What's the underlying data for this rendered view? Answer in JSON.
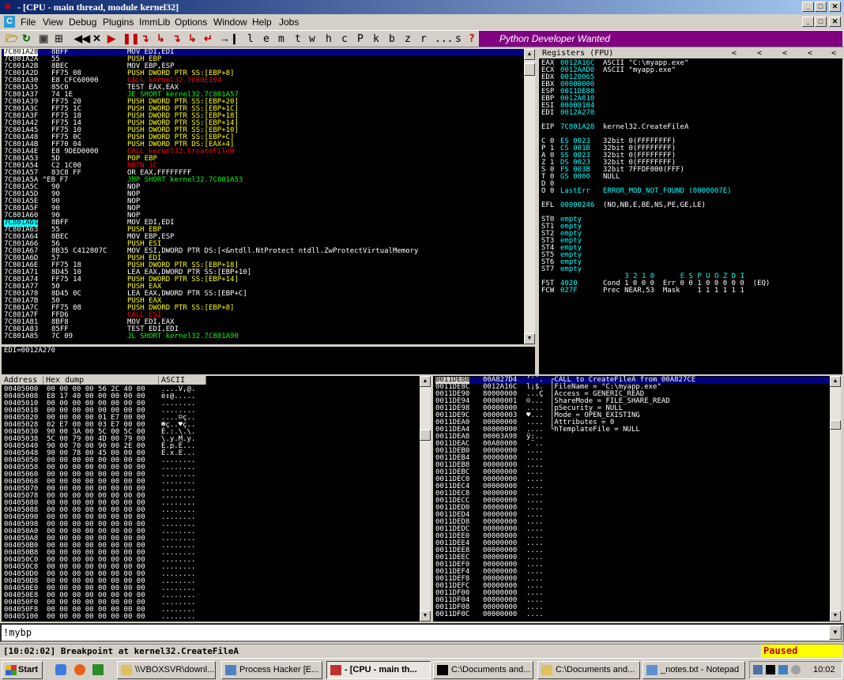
{
  "window": {
    "title": "- [CPU - main thread, module kernel32]"
  },
  "menu": [
    "File",
    "View",
    "Debug",
    "Plugins",
    "ImmLib",
    "Options",
    "Window",
    "Help",
    "Jobs"
  ],
  "toolbar": {
    "letters": [
      "l",
      "e",
      "m",
      "t",
      "w",
      "h",
      "c",
      "P",
      "k",
      "b",
      "z",
      "r",
      "...",
      "s",
      "?"
    ],
    "banner": "Python Developer Wanted"
  },
  "disasm": {
    "rows": [
      [
        "7C801A28",
        "8BFF",
        "MOV EDI,EDI",
        "mov"
      ],
      [
        "7C801A2A",
        "55",
        "PUSH EBP",
        "push"
      ],
      [
        "7C801A2B",
        "8BEC",
        "MOV EBP,ESP",
        "mov"
      ],
      [
        "7C801A2D",
        "FF75 08",
        "PUSH DWORD PTR SS:[EBP+8]",
        "push"
      ],
      [
        "7C801A30",
        "E8 CFC60000",
        "CALL kernel32.7C80E104",
        "call"
      ],
      [
        "7C801A35",
        "85C0",
        "TEST EAX,EAX",
        "test"
      ],
      [
        "7C801A37",
        "74 1E",
        "JE SHORT kernel32.7C801A57",
        "jmp"
      ],
      [
        "7C801A39",
        "FF75 20",
        "PUSH DWORD PTR SS:[EBP+20]",
        "push"
      ],
      [
        "7C801A3C",
        "FF75 1C",
        "PUSH DWORD PTR SS:[EBP+1C]",
        "push"
      ],
      [
        "7C801A3F",
        "FF75 18",
        "PUSH DWORD PTR SS:[EBP+18]",
        "push"
      ],
      [
        "7C801A42",
        "FF75 14",
        "PUSH DWORD PTR SS:[EBP+14]",
        "push"
      ],
      [
        "7C801A45",
        "FF75 10",
        "PUSH DWORD PTR SS:[EBP+10]",
        "push"
      ],
      [
        "7C801A48",
        "FF75 0C",
        "PUSH DWORD PTR SS:[EBP+C]",
        "push"
      ],
      [
        "7C801A4B",
        "FF70 04",
        "PUSH DWORD PTR DS:[EAX+4]",
        "push"
      ],
      [
        "7C801A4E",
        "E8 9DED0000",
        "CALL kernel32.CreateFileW",
        "call"
      ],
      [
        "7C801A53",
        "5D",
        "POP EBP",
        "push"
      ],
      [
        "7C801A54",
        "C2 1C00",
        "RETN 1C",
        "ret"
      ],
      [
        "7C801A57",
        "83C8 FF",
        "OR EAX,FFFFFFFF",
        "test"
      ],
      [
        "7C801A5A ^EB F7",
        "",
        "JMP SHORT kernel32.7C801A53",
        "jmp"
      ],
      [
        "7C801A5C",
        "90",
        "NOP",
        "mov"
      ],
      [
        "7C801A5D",
        "90",
        "NOP",
        "mov"
      ],
      [
        "7C801A5E",
        "90",
        "NOP",
        "mov"
      ],
      [
        "7C801A5F",
        "90",
        "NOP",
        "mov"
      ],
      [
        "7C801A60",
        "90",
        "NOP",
        "mov"
      ],
      [
        "7C801A61",
        "8BFF",
        "MOV EDI,EDI",
        "test"
      ],
      [
        "7C801A63",
        "55",
        "PUSH EBP",
        "push"
      ],
      [
        "7C801A64",
        "8BEC",
        "MOV EBP,ESP",
        "test"
      ],
      [
        "7C801A66",
        "56",
        "PUSH ESI",
        "push"
      ],
      [
        "7C801A67",
        "8B35 C412807C",
        "MOV ESI,DWORD PTR DS:[<&ntdll.NtProtect ntdll.ZwProtectVirtualMemory",
        "test"
      ],
      [
        "7C801A6D",
        "57",
        "PUSH EDI",
        "push"
      ],
      [
        "7C801A6E",
        "FF75 18",
        "PUSH DWORD PTR SS:[EBP+18]",
        "push"
      ],
      [
        "7C801A71",
        "8D45 10",
        "LEA EAX,DWORD PTR SS:[EBP+10]",
        "mov"
      ],
      [
        "7C801A74",
        "FF75 14",
        "PUSH DWORD PTR SS:[EBP+14]",
        "push"
      ],
      [
        "7C801A77",
        "50",
        "PUSH EAX",
        "push"
      ],
      [
        "7C801A78",
        "8D45 0C",
        "LEA EAX,DWORD PTR SS:[EBP+C]",
        "mov"
      ],
      [
        "7C801A7B",
        "50",
        "PUSH EAX",
        "push"
      ],
      [
        "7C801A7C",
        "FF75 08",
        "PUSH DWORD PTR SS:[EBP+8]",
        "push"
      ],
      [
        "7C801A7F",
        "FFD6",
        "CALL ESI",
        "call"
      ],
      [
        "7C801A81",
        "8BF8",
        "MOV EDI,EAX",
        "test"
      ],
      [
        "7C801A83",
        "85FF",
        "TEST EDI,EDI",
        "test"
      ],
      [
        "7C801A85",
        "7C 09",
        "JL SHORT kernel32.7C801A90",
        "jmp"
      ]
    ],
    "info": "EDI=0012A270"
  },
  "registers": {
    "title": "Registers (FPU)",
    "lines": [
      [
        "EAX",
        "0012A16C",
        "ASCII \"C:\\myapp.exe\""
      ],
      [
        "ECX",
        "0012AAD0",
        "ASCII \"myapp.exe\""
      ],
      [
        "EDX",
        "00120065",
        ""
      ],
      [
        "EBX",
        "00000000",
        ""
      ],
      [
        "ESP",
        "0011DE88",
        ""
      ],
      [
        "EBP",
        "0012A810",
        ""
      ],
      [
        "ESI",
        "00000104",
        ""
      ],
      [
        "EDI",
        "0012A270",
        ""
      ],
      [
        "",
        "",
        " "
      ],
      [
        "EIP",
        "7C801A28",
        "kernel32.CreateFileA"
      ],
      [
        "",
        "",
        " "
      ],
      [
        "C 0",
        "ES 0023",
        "32bit 0(FFFFFFFF)"
      ],
      [
        "P 1",
        "CS 001B",
        "32bit 0(FFFFFFFF)"
      ],
      [
        "A 0",
        "SS 0023",
        "32bit 0(FFFFFFFF)"
      ],
      [
        "Z 1",
        "DS 0023",
        "32bit 0(FFFFFFFF)"
      ],
      [
        "S 0",
        "FS 003B",
        "32bit 7FFDF000(FFF)"
      ],
      [
        "T 0",
        "GS 0000",
        "NULL"
      ],
      [
        "D 0",
        "",
        ""
      ],
      [
        "O 0",
        "LastErr",
        "ERROR_MOD_NOT_FOUND (0000007E)"
      ],
      [
        "",
        "",
        " "
      ],
      [
        "EFL",
        "00000246",
        "(NO,NB,E,BE,NS,PE,GE,LE)"
      ],
      [
        "",
        "",
        " "
      ],
      [
        "ST0",
        "empty",
        ""
      ],
      [
        "ST1",
        "empty",
        ""
      ],
      [
        "ST2",
        "empty",
        ""
      ],
      [
        "ST3",
        "empty",
        ""
      ],
      [
        "ST4",
        "empty",
        ""
      ],
      [
        "ST5",
        "empty",
        ""
      ],
      [
        "ST6",
        "empty",
        ""
      ],
      [
        "ST7",
        "empty",
        ""
      ],
      [
        "",
        "               3 2 1 0      E S P U O Z D I",
        ""
      ],
      [
        "FST",
        "4020",
        "Cond 1 0 0 0  Err 0 0 1 0 0 0 0 0  (EQ)"
      ],
      [
        "FCW",
        "027F",
        "Prec NEAR,53  Mask    1 1 1 1 1 1"
      ]
    ]
  },
  "dump": {
    "headers": [
      "Address",
      "Hex dump",
      "ASCII"
    ],
    "rows": [
      [
        "00405000",
        "00 00 00 00 56 2C 40 00",
        "....V,@."
      ],
      [
        "00405008",
        "E8 17 40 00 00 00 00 00",
        "è↕@....."
      ],
      [
        "00405010",
        "00 00 00 00 00 00 00 00",
        "........"
      ],
      [
        "00405018",
        "00 00 00 00 00 00 00 00",
        "........"
      ],
      [
        "00405020",
        "00 00 00 00 01 E7 00 00",
        "....☺ç.."
      ],
      [
        "00405028",
        "02 E7 00 00 03 E7 00 00",
        "☻ç..♥ç.."
      ],
      [
        "00405030",
        "90 00 3A 00 5C 00 5C 00",
        "É.:.\\.\\."
      ],
      [
        "00405038",
        "5C 00 79 00 4D 00 79 00",
        "\\.y.M.y."
      ],
      [
        "00405040",
        "90 00 70 00 90 00 2E 00",
        "É.p.É..."
      ],
      [
        "00405048",
        "90 00 78 00 45 00 00 00",
        "É.x.E..."
      ],
      [
        "00405050",
        "00 00 00 00 00 00 00 00",
        "........"
      ],
      [
        "00405058",
        "00 00 00 00 00 00 00 00",
        "........"
      ],
      [
        "00405060",
        "00 00 00 00 00 00 00 00",
        "........"
      ],
      [
        "00405068",
        "00 00 00 00 00 00 00 00",
        "........"
      ],
      [
        "00405070",
        "00 00 00 00 00 00 00 00",
        "........"
      ],
      [
        "00405078",
        "00 00 00 00 00 00 00 00",
        "........"
      ],
      [
        "00405080",
        "00 00 00 00 00 00 00 00",
        "........"
      ],
      [
        "00405088",
        "00 00 00 00 00 00 00 00",
        "........"
      ],
      [
        "00405090",
        "00 00 00 00 00 00 00 00",
        "........"
      ],
      [
        "00405098",
        "00 00 00 00 00 00 00 00",
        "........"
      ],
      [
        "004050A0",
        "00 00 00 00 00 00 00 00",
        "........"
      ],
      [
        "004050A8",
        "00 00 00 00 00 00 00 00",
        "........"
      ],
      [
        "004050B0",
        "00 00 00 00 00 00 00 00",
        "........"
      ],
      [
        "004050B8",
        "00 00 00 00 00 00 00 00",
        "........"
      ],
      [
        "004050C0",
        "00 00 00 00 00 00 00 00",
        "........"
      ],
      [
        "004050C8",
        "00 00 00 00 00 00 00 00",
        "........"
      ],
      [
        "004050D0",
        "00 00 00 00 00 00 00 00",
        "........"
      ],
      [
        "004050D8",
        "00 00 00 00 00 00 00 00",
        "........"
      ],
      [
        "004050E0",
        "00 00 00 00 00 00 00 00",
        "........"
      ],
      [
        "004050E8",
        "00 00 00 00 00 00 00 00",
        "........"
      ],
      [
        "004050F0",
        "00 00 00 00 00 00 00 00",
        "........"
      ],
      [
        "004050F8",
        "00 00 00 00 00 00 00 00",
        "........"
      ],
      [
        "00405100",
        "00 00 00 00 00 00 00 00",
        "........"
      ]
    ]
  },
  "stack": {
    "rows": [
      [
        "0011DE88",
        "00A827D4",
        "’'¨.",
        "┌CALL to CreateFileA from 00A827CE",
        true
      ],
      [
        "0011DE8C",
        "0012A16C",
        "l¡$.",
        "│FileName = \"C:\\myapp.exe\"",
        false
      ],
      [
        "0011DE90",
        "80000000",
        "...Ç",
        "│Access = GENERIC_READ",
        false
      ],
      [
        "0011DE94",
        "00000001",
        "☺...",
        "│ShareMode = FILE_SHARE_READ",
        false
      ],
      [
        "0011DE98",
        "00000000",
        "....",
        "│pSecurity = NULL",
        false
      ],
      [
        "0011DE9C",
        "00000003",
        "♥...",
        "│Mode = OPEN_EXISTING",
        false
      ],
      [
        "0011DEA0",
        "00000000",
        "....",
        "│Attributes = 0",
        false
      ],
      [
        "0011DEA4",
        "00000000",
        "....",
        "└hTemplateFile = NULL",
        false
      ],
      [
        "0011DEA8",
        "00003A98",
        "ÿ:..",
        "",
        false
      ],
      [
        "0011DEAC",
        "00A80000",
        ".¨..",
        "",
        false
      ],
      [
        "0011DEB0",
        "00000000",
        "....",
        "",
        false
      ],
      [
        "0011DEB4",
        "00000000",
        "....",
        "",
        false
      ],
      [
        "0011DEB8",
        "00000000",
        "....",
        "",
        false
      ],
      [
        "0011DEBC",
        "00000000",
        "....",
        "",
        false
      ],
      [
        "0011DEC0",
        "00000000",
        "....",
        "",
        false
      ],
      [
        "0011DEC4",
        "00000000",
        "....",
        "",
        false
      ],
      [
        "0011DEC8",
        "00000000",
        "....",
        "",
        false
      ],
      [
        "0011DECC",
        "00000000",
        "....",
        "",
        false
      ],
      [
        "0011DED0",
        "00000000",
        "....",
        "",
        false
      ],
      [
        "0011DED4",
        "00000000",
        "....",
        "",
        false
      ],
      [
        "0011DED8",
        "00000000",
        "....",
        "",
        false
      ],
      [
        "0011DEDC",
        "00000000",
        "....",
        "",
        false
      ],
      [
        "0011DEE0",
        "00000000",
        "....",
        "",
        false
      ],
      [
        "0011DEE4",
        "00000000",
        "....",
        "",
        false
      ],
      [
        "0011DEE8",
        "00000000",
        "....",
        "",
        false
      ],
      [
        "0011DEEC",
        "00000000",
        "....",
        "",
        false
      ],
      [
        "0011DEF0",
        "00000000",
        "....",
        "",
        false
      ],
      [
        "0011DEF4",
        "00000000",
        "....",
        "",
        false
      ],
      [
        "0011DEF8",
        "00000000",
        "....",
        "",
        false
      ],
      [
        "0011DEFC",
        "00000000",
        "....",
        "",
        false
      ],
      [
        "0011DF00",
        "00000000",
        "....",
        "",
        false
      ],
      [
        "0011DF04",
        "00000000",
        "....",
        "",
        false
      ],
      [
        "0011DF08",
        "00000000",
        "....",
        "",
        false
      ],
      [
        "0011DF0C",
        "00000000",
        "....",
        "",
        false
      ]
    ]
  },
  "command": {
    "value": "!mybp"
  },
  "status": {
    "message": "[10:02:02] Breakpoint at kernel32.CreateFileA",
    "state": "Paused"
  },
  "taskbar": {
    "start": "Start",
    "buttons": [
      "\\\\VBOXSVR\\downl...",
      "Process Hacker [E...",
      "- [CPU - main th...",
      "C:\\Documents and...",
      "C:\\Documents and...",
      "_notes.txt - Notepad"
    ],
    "clock": "10:02"
  },
  "colors": {
    "mov": "#ffffff",
    "push": "#ffff00",
    "call": "#ff0000",
    "jmp": "#ffff00",
    "test": "#ffffff",
    "ret": "#ff0000",
    "operand": "#ff00ff"
  }
}
